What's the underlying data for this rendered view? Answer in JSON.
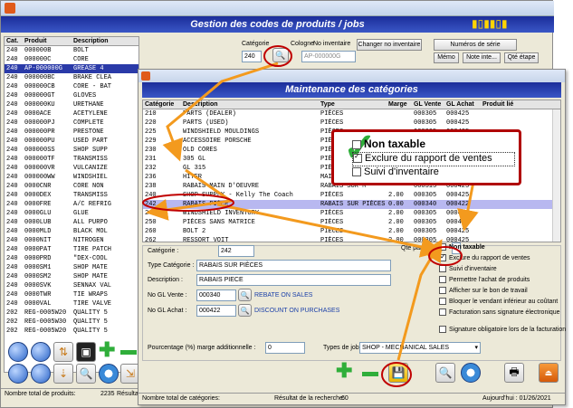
{
  "back_window": {
    "title": "Gestion des codes de produits / jobs",
    "columns": [
      "Cat.",
      "Produit",
      "Description"
    ],
    "rows": [
      [
        "240",
        "000000B",
        "BOLT"
      ],
      [
        "240",
        "000000C",
        "CORE"
      ],
      [
        "240",
        "AP-000000G",
        "GREASE 4"
      ],
      [
        "240",
        "000000BC",
        "BRAKE CLEA"
      ],
      [
        "240",
        "000000CB",
        "CORE - BAT"
      ],
      [
        "240",
        "000000GT",
        "GLOVES"
      ],
      [
        "240",
        "000000KU",
        "URETHANE"
      ],
      [
        "240",
        "0000ACE",
        "ACETYLENE"
      ],
      [
        "240",
        "000000PJ",
        "COMPLETE"
      ],
      [
        "240",
        "000000PR",
        "PRESTONE"
      ],
      [
        "240",
        "000000PU",
        "USED PART"
      ],
      [
        "240",
        "000000SS",
        "SHOP SUPP"
      ],
      [
        "240",
        "000000TF",
        "TRANSMISS"
      ],
      [
        "240",
        "000000VR",
        "VULCANIZE"
      ],
      [
        "240",
        "000000WW",
        "WINDSHIEL"
      ],
      [
        "240",
        "0000CNR",
        "CORE NON"
      ],
      [
        "240",
        "0000DEX",
        "TRANSMISS"
      ],
      [
        "240",
        "0000FRE",
        "A/C REFRIG"
      ],
      [
        "240",
        "0000GLU",
        "GLUE"
      ],
      [
        "240",
        "0000LUB",
        "ALL PURPO"
      ],
      [
        "240",
        "0000MLD",
        "BLACK MOL"
      ],
      [
        "240",
        "0000NIT",
        "NITROGEN"
      ],
      [
        "240",
        "0000PAT",
        "TIRE PATCH"
      ],
      [
        "240",
        "0000PRD",
        "\"DEX-COOL"
      ],
      [
        "240",
        "0000SM1",
        "SHOP MATE"
      ],
      [
        "240",
        "0000SM2",
        "SHOP MATE"
      ],
      [
        "240",
        "0000SVK",
        "SENNAX VAL"
      ],
      [
        "240",
        "0000TWR",
        "TIE WRAPS"
      ],
      [
        "240",
        "0000VAL",
        "TIRE VALVE"
      ],
      [
        "202",
        "REG-0005W20",
        "QUALITY 5"
      ],
      [
        "202",
        "REG-0005W30",
        "QUALITY 5"
      ],
      [
        "202",
        "REG-0005W20",
        "QUALITY 5"
      ]
    ],
    "selected_row_index": 2,
    "categorie_label": "Catégorie",
    "categorie_value": "240",
    "cologne_label": "Cologne",
    "no_inventaire_label": "No inventaire",
    "product_code_value": "AP-000000G",
    "changer_button": "Changer no inventaire",
    "numeros_serie_button": "Numéros de série",
    "memo_button": "Mémo",
    "note_inte_button": "Note inte...",
    "qte_etape_button": "Qté étape",
    "footer_total_label": "Nombre total de produits:",
    "footer_total_value": "2235",
    "footer_result_label": "Résultat"
  },
  "front_window": {
    "title": "Maintenance des catégories",
    "columns": [
      "Catégorie",
      "Description",
      "Type",
      "Marge",
      "GL Vente",
      "GL Achat",
      "Produit lié"
    ],
    "rows": [
      [
        "210",
        "PARTS (DEALER)",
        "PIÈCES",
        "",
        "000305",
        "000425",
        ""
      ],
      [
        "220",
        "PARTS (USED)",
        "PIÈCES",
        "",
        "000305",
        "000425",
        ""
      ],
      [
        "225",
        "WINDSHIELD MOULDINGS",
        "PIÈCES",
        "",
        "000305",
        "000425",
        ""
      ],
      [
        "229",
        "ACCESSOIRE PORSCHE",
        "PIÈCES",
        "",
        "000305",
        "000425",
        ""
      ],
      [
        "230",
        "OLD CORES",
        "PIÈCES",
        "",
        "000305",
        "000425",
        ""
      ],
      [
        "231",
        "305 GL",
        "PIÈCES",
        "",
        "000305",
        "000425",
        ""
      ],
      [
        "232",
        "GL 315",
        "PIÈCES",
        "",
        "000305",
        "000425",
        ""
      ],
      [
        "236",
        "HITER",
        "MAIN-D'ŒUVRE",
        "",
        "000315",
        "000425",
        ""
      ],
      [
        "238",
        "RABAIS MAIN D'OEUVRE",
        "RABAIS SUR M",
        "",
        "000315",
        "000425",
        ""
      ],
      [
        "240",
        "SHOP SUPPLY - Kelly The Coach",
        "PIÈCES",
        "2.00",
        "000305",
        "000425",
        ""
      ],
      [
        "242",
        "RABAIS PIÈCE",
        "RABAIS SUR PIÈCES",
        "0.00",
        "000340",
        "000422",
        ""
      ],
      [
        "246",
        "WINDSHIELD INVENTORY",
        "PIÈCES",
        "2.00",
        "000305",
        "000425",
        ""
      ],
      [
        "250",
        "PIÈCES SANS MATRICE",
        "PIÈCES",
        "2.00",
        "000305",
        "000425",
        ""
      ],
      [
        "260",
        "BOLT 2",
        "PIÈCES",
        "2.00",
        "000305",
        "000425",
        ""
      ],
      [
        "262",
        "RESSORT VOIT",
        "PIÈCES",
        "2.00",
        "000305",
        "000425",
        ""
      ]
    ],
    "selected_row_index": 10,
    "categorie_label": "Catégorie :",
    "categorie_value": "242",
    "qte_defaut_label": "Qte par défaut :",
    "type_categorie_label": "Type Catégorie :",
    "type_categorie_value": "RABAIS SUR PIÈCES",
    "description_label": "Description :",
    "description_value": "RABAIS PIECE",
    "gl_vente_label": "No GL Vente :",
    "gl_vente_value": "000340",
    "gl_vente_desc": "REBATE ON SALES",
    "gl_achat_label": "No GL Achat :",
    "gl_achat_value": "000422",
    "gl_achat_desc": "DISCOUNT ON PURCHASES",
    "marge_label": "Pourcentage (%) marge additionnelle :",
    "marge_value": "0",
    "types_job_label": "Types de job :",
    "types_job_value": "SHOP - MECHANICAL SALES",
    "checkboxes": [
      {
        "label": "Non taxable",
        "checked": false,
        "bold": true
      },
      {
        "label": "Exclure du rapport de ventes",
        "checked": true,
        "bold": false
      },
      {
        "label": "Suivi d'inventaire",
        "checked": false,
        "bold": false
      },
      {
        "label": "Permettre l'achat de produits",
        "checked": false,
        "bold": false
      },
      {
        "label": "Afficher sur le bon de travail",
        "checked": false,
        "bold": false
      },
      {
        "label": "Bloquer le vendant inférieur au coûtant",
        "checked": false,
        "bold": false
      },
      {
        "label": "Facturation sans signature électronique",
        "checked": false,
        "bold": false
      }
    ],
    "signature_label": "Signature obligatoire lors de la facturation",
    "footer_total_label": "Nombre total de catégories:",
    "footer_result_label": "Résultat de la recherche:",
    "footer_result_value": "60",
    "footer_date": "Aujourd'hui : 01/26/2021"
  },
  "zoom_callout": {
    "items": [
      {
        "label": "Non taxable",
        "checked": false
      },
      {
        "label": "Exclure du rapport de ventes",
        "checked": true
      },
      {
        "label": "Suivi d'inventaire",
        "checked": false
      }
    ]
  },
  "colors": {
    "title_bar": "#1b2d9a",
    "selection": "#2a3aa8",
    "selection_front": "#b8b8f0",
    "annotation_red": "#c00000",
    "annotation_orange": "#f39a1e",
    "checkmark_green": "#2fae3a"
  }
}
